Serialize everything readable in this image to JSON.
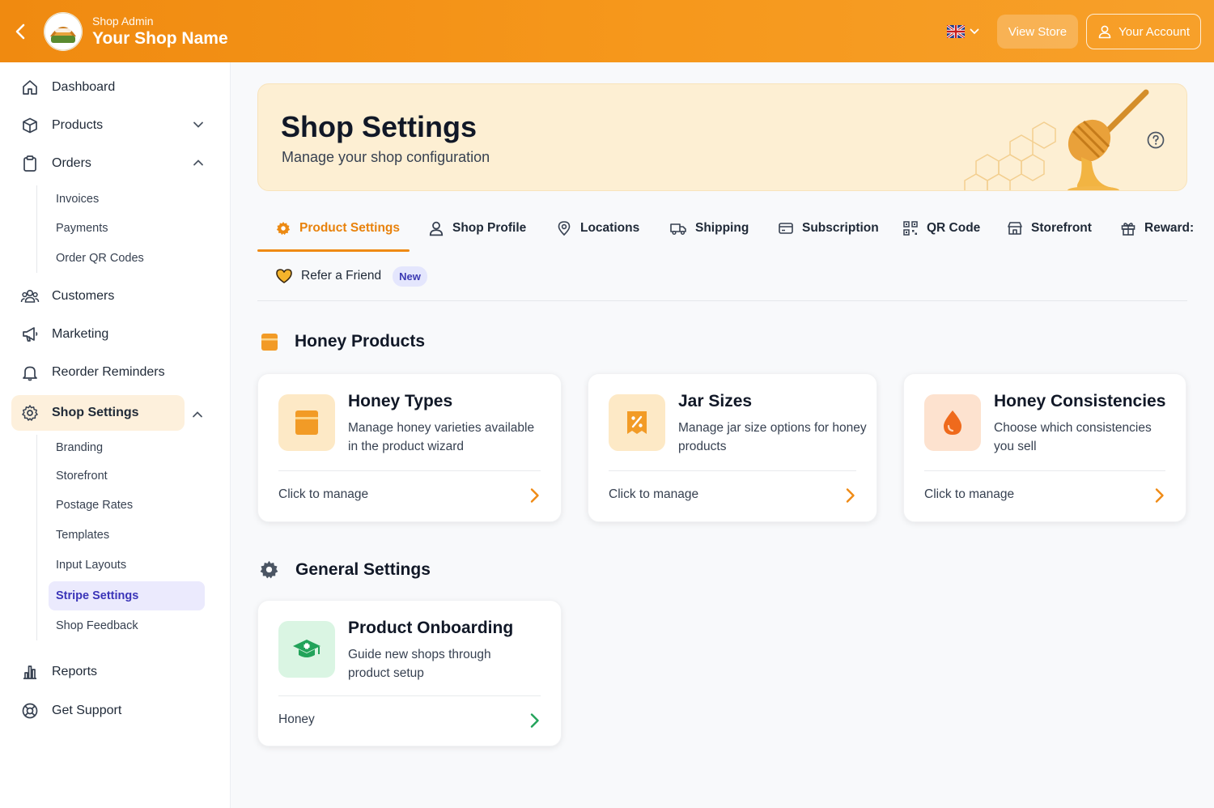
{
  "header": {
    "subtitle": "Shop Admin",
    "title": "Your Shop Name",
    "view_store": "View Store",
    "account": "Your Account",
    "language": "en-GB"
  },
  "sidebar": {
    "items": [
      {
        "label": "Dashboard",
        "icon": "home-icon"
      },
      {
        "label": "Products",
        "icon": "box-icon",
        "expanded": false
      },
      {
        "label": "Orders",
        "icon": "clipboard-icon",
        "expanded": true
      },
      {
        "label": "Customers",
        "icon": "users-icon"
      },
      {
        "label": "Marketing",
        "icon": "megaphone-icon"
      },
      {
        "label": "Reorder Reminders",
        "icon": "bell-icon"
      },
      {
        "label": "Shop Settings",
        "icon": "gear-icon",
        "expanded": true
      },
      {
        "label": "Reports",
        "icon": "bar-chart-icon"
      },
      {
        "label": "Get Support",
        "icon": "lifebuoy-icon"
      }
    ],
    "orders_sub": [
      "Invoices",
      "Payments",
      "Order QR Codes"
    ],
    "settings_sub": [
      "Branding",
      "Storefront",
      "Postage Rates",
      "Templates",
      "Input Layouts",
      "Stripe Settings",
      "Shop Feedback"
    ],
    "selected_sub": "Stripe Settings"
  },
  "hero": {
    "title": "Shop Settings",
    "subtitle": "Manage your shop configuration"
  },
  "tabs": [
    {
      "label": "Product Settings",
      "icon": "gear-icon",
      "active": true
    },
    {
      "label": "Shop Profile",
      "icon": "user-icon"
    },
    {
      "label": "Locations",
      "icon": "map-pin-icon"
    },
    {
      "label": "Shipping",
      "icon": "truck-icon"
    },
    {
      "label": "Subscription",
      "icon": "credit-card-icon"
    },
    {
      "label": "QR Code",
      "icon": "qr-code-icon"
    },
    {
      "label": "Storefront",
      "icon": "store-icon"
    },
    {
      "label": "Reward:",
      "icon": "gift-icon"
    },
    {
      "label": "Refer a Friend",
      "icon": "heart-icon",
      "badge": "New"
    }
  ],
  "sections": {
    "honey_products": "Honey Products",
    "general_settings": "General Settings"
  },
  "cards": [
    {
      "title": "Honey Types",
      "desc": "Manage honey varieties available in the product wizard",
      "footer": "Click to manage"
    },
    {
      "title": "Jar Sizes",
      "desc": "Manage jar size options for honey products",
      "footer": "Click to manage"
    },
    {
      "title": "Honey Consistencies",
      "desc": "Choose which consistencies you sell",
      "footer": "Click to manage"
    },
    {
      "title": "Product Onboarding",
      "desc": "Guide new shops through product setup",
      "footer": "Honey"
    }
  ],
  "colors": {
    "accent": "#f08a10",
    "active_tab": "#e8820c",
    "selected_sub_bg": "#ebeafd",
    "selected_sub_text": "#3b35b8",
    "green": "#22a35a"
  }
}
